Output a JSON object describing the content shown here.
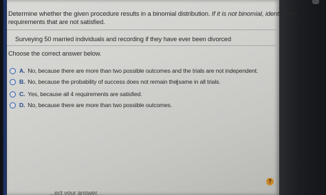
{
  "question": {
    "prompt_plain": "Determine whether the given procedure results in a binomial distribution.",
    "prompt_italic": "If it is not binomial, identify the",
    "prompt_line2": "requirements that are not satisfied."
  },
  "scenario": "Surveying 50 married individuals and recording if they have ever been divorced",
  "instruction": "Choose the correct answer below.",
  "options": [
    {
      "letter": "A.",
      "text": "No, because there are more than two possible outcomes and the trials are not independent."
    },
    {
      "letter": "B.",
      "text": "No, because the probability of success does not remain the same in all trials."
    },
    {
      "letter": "C.",
      "text": "Yes, because all 4 requirements are satisfied."
    },
    {
      "letter": "D.",
      "text": "No, because there are more than two possible outcomes."
    }
  ],
  "footer": {
    "text": "...ect your answer."
  },
  "icons": {
    "help": "?",
    "cursor": "I"
  }
}
